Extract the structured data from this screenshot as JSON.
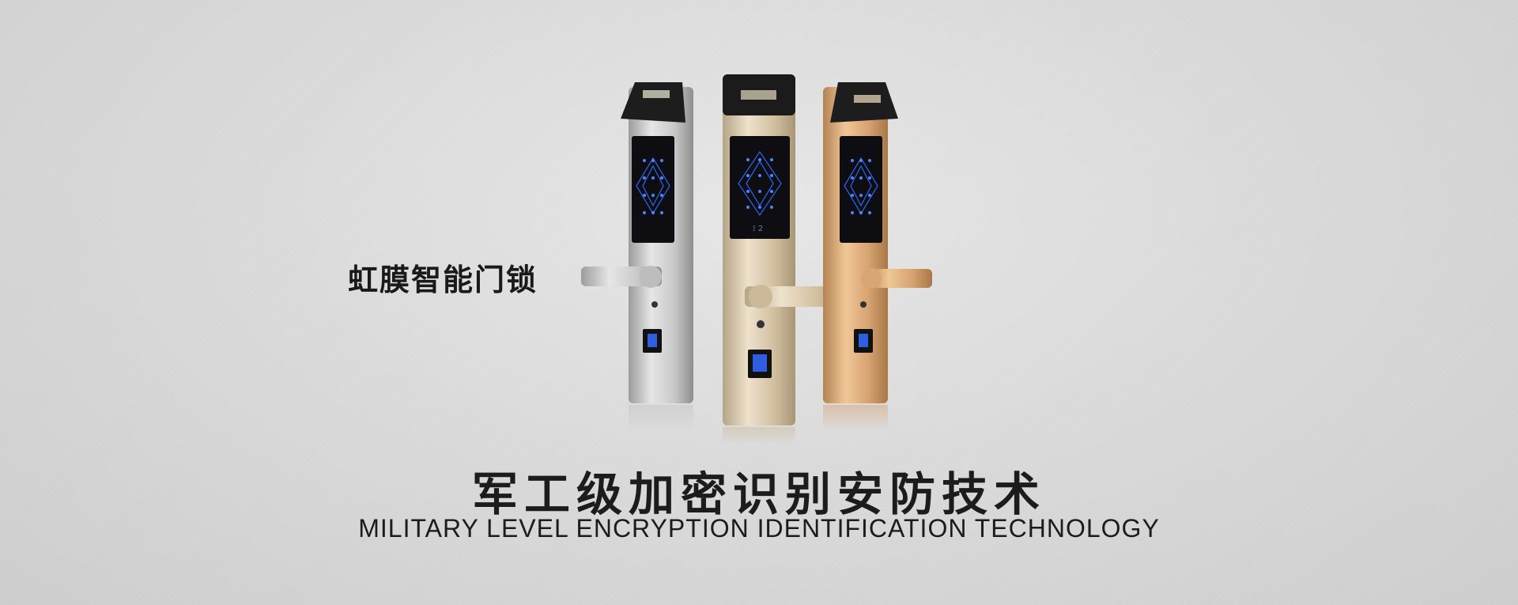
{
  "banner": {
    "product_title": "虹膜智能门锁",
    "headline_cn": "军工级加密识别安防技术",
    "headline_en": "MILITARY LEVEL ENCRYPTION IDENTIFICATION TECHNOLOGY"
  },
  "locks": [
    {
      "name": "silver",
      "color": "#c8c8c8"
    },
    {
      "name": "champagne",
      "color": "#d6c3a4"
    },
    {
      "name": "rose-gold",
      "color": "#d9a877"
    }
  ],
  "colors": {
    "background": "#dcdcdc",
    "text": "#1a1a1a",
    "keypad_glow": "#2f6bff"
  }
}
